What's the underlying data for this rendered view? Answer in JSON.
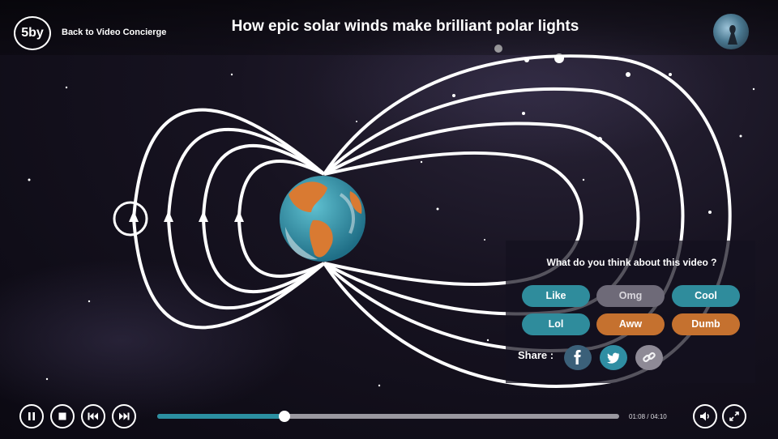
{
  "header": {
    "logo_text": "5by",
    "back_label": "Back to Video Concierge",
    "title": "How epic solar winds make brilliant polar lights"
  },
  "reaction_panel": {
    "question": "What do you think about this video ?",
    "buttons": [
      {
        "label": "Like",
        "color": "#2f8c9c"
      },
      {
        "label": "Omg",
        "color": "#6e6a78"
      },
      {
        "label": "Cool",
        "color": "#2f8c9c"
      },
      {
        "label": "Lol",
        "color": "#2f8c9c"
      },
      {
        "label": "Aww",
        "color": "#c5712f"
      },
      {
        "label": "Dumb",
        "color": "#c5712f"
      }
    ],
    "share_label": "Share :",
    "share_icons": [
      "facebook-icon",
      "twitter-icon",
      "link-icon"
    ]
  },
  "player": {
    "current_time": "01:08",
    "separator": " / ",
    "duration": "04:10",
    "progress": 0.275,
    "accent_color": "#2b8fa1",
    "controls": [
      "pause-icon",
      "stop-icon",
      "skip-back-icon",
      "skip-forward-icon",
      "volume-icon",
      "fullscreen-icon"
    ]
  }
}
